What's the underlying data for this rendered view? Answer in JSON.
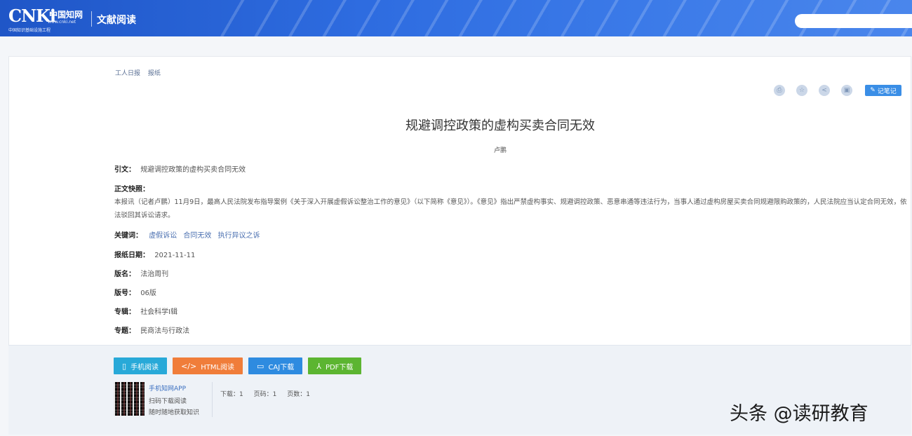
{
  "header": {
    "logo_main": "CNKi",
    "logo_brand": "中国知网",
    "logo_sub": "www.cnki.net",
    "logo_sub2": "中国知识基础设施工程",
    "site_name": "文献阅读",
    "search": {
      "placeholder": "",
      "value": ""
    }
  },
  "breadcrumb": [
    "工人日报",
    "报纸"
  ],
  "toolbar": {
    "icons": [
      "print-icon",
      "favorite-icon",
      "share-icon",
      "note-icon"
    ],
    "icon_glyphs": [
      "⎙",
      "☆",
      "<",
      "▣"
    ],
    "edit_label": "记笔记"
  },
  "article": {
    "title": "规避调控政策的虚构买卖合同无效",
    "author": "卢鹏",
    "fields": {
      "citation_label": "引文：",
      "citation_value": "规避调控政策的虚构买卖合同无效",
      "abstract_label": "正文快照：",
      "abstract_text": "本报讯（记者卢鹏）11月9日，最高人民法院发布指导案例《关于深入开展虚假诉讼整治工作的意见》（以下简称《意见》）。《意见》指出严禁虚构事实、规避调控政策、恶意串通等违法行为，当事人通过虚构房屋买卖合同规避限购政策的，人民法院应当认定合同无效，依法驳回其诉讼请求。",
      "keywords_label": "关键词：",
      "keywords": [
        "虚假诉讼",
        "合同无效",
        "执行异议之诉"
      ],
      "date_label": "报纸日期：",
      "date_value": "2021-11-11",
      "section_label": "版名：",
      "section_value": "法治周刊",
      "page_label": "版号：",
      "page_value": "06版",
      "series_label": "专辑：",
      "series_value": "社会科学Ⅰ辑",
      "topic_label": "专题：",
      "topic_value": "民商法与行政法"
    }
  },
  "downloads": {
    "buttons": [
      {
        "label": "手机阅读",
        "icon": "▯",
        "color": "#28a9d8"
      },
      {
        "label": "HTML阅读",
        "icon": "</>",
        "color": "#f07d3a"
      },
      {
        "label": "CAJ下载",
        "icon": "▭",
        "color": "#2e8be0"
      },
      {
        "label": "PDF下载",
        "icon": "⅄",
        "color": "#5cb531"
      }
    ],
    "qr_lines": [
      "手机知网APP",
      "扫码下载阅读",
      "随时随地获取知识"
    ],
    "stats": [
      "下载：1",
      "页码：1",
      "页数：1"
    ]
  },
  "watermark": "头条 @读研教育"
}
